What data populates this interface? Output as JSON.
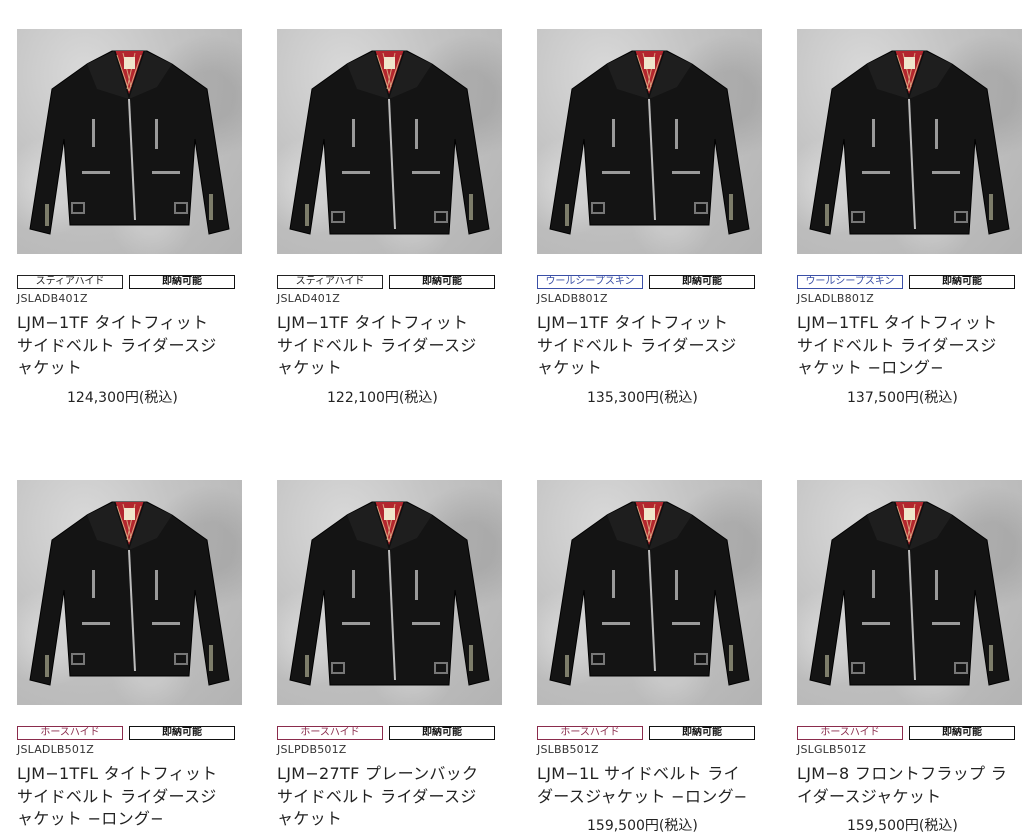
{
  "products": [
    {
      "material": "スティアハイド",
      "material_style": "steer",
      "stock": "即納可能",
      "code": "JSLADB401Z",
      "name": "LJM−1TF タイトフィット サイドベルト ライダースジャケット",
      "price": "124,300円(税込)"
    },
    {
      "material": "スティアハイド",
      "material_style": "steer",
      "stock": "即納可能",
      "code": "JSLAD401Z",
      "name": "LJM−1TF タイトフィット サイドベルト ライダースジャケット",
      "price": "122,100円(税込)"
    },
    {
      "material": "ウールシープスキン",
      "material_style": "wool",
      "stock": "即納可能",
      "code": "JSLADB801Z",
      "name": "LJM−1TF タイトフィット サイドベルト ライダースジャケット",
      "price": "135,300円(税込)"
    },
    {
      "material": "ウールシープスキン",
      "material_style": "wool",
      "stock": "即納可能",
      "code": "JSLADLB801Z",
      "name": "LJM−1TFL タイトフィット サイドベルト ライダースジャケット −ロング−",
      "price": "137,500円(税込)"
    },
    {
      "material": "ホースハイド",
      "material_style": "horse",
      "stock": "即納可能",
      "code": "JSLADLB501Z",
      "name": "LJM−1TFL タイトフィット サイドベルト ライダースジャケット −ロング−",
      "price": ""
    },
    {
      "material": "ホースハイド",
      "material_style": "horse",
      "stock": "即納可能",
      "code": "JSLPDB501Z",
      "name": "LJM−27TF プレーンバック サイドベルト ライダースジャケット",
      "price": ""
    },
    {
      "material": "ホースハイド",
      "material_style": "horse",
      "stock": "即納可能",
      "code": "JSLBB501Z",
      "name": "LJM−1L サイドベルト ライダースジャケット −ロング−",
      "price": "159,500円(税込)"
    },
    {
      "material": "ホースハイド",
      "material_style": "horse",
      "stock": "即納可能",
      "code": "JSLGLB501Z",
      "name": "LJM−8 フロントフラップ ライダースジャケット",
      "price": "159,500円(税込)"
    }
  ],
  "colors": {
    "steer": "#222222",
    "wool": "#3a4fa6",
    "horse": "#8a2b4c",
    "jacket": "#141414",
    "lining": "#b3262e"
  }
}
